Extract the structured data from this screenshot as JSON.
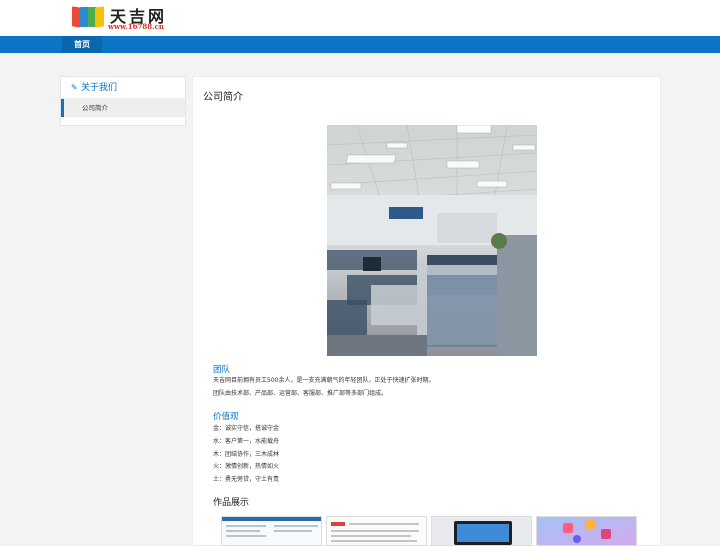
{
  "header": {
    "logo_text": "天吉网",
    "logo_url": "www.16788.cn"
  },
  "nav": {
    "home": "首页"
  },
  "sidebar": {
    "title": "关于我们",
    "items": [
      {
        "label": "公司简介"
      }
    ]
  },
  "main": {
    "title": "公司简介",
    "team": {
      "heading": "团队",
      "lines": [
        "天吉网目前拥有员工500余人，是一支充满朝气的年轻团队，正处于快速扩张时期。",
        "团队由技术部、产品部、运营部、客服部、推广部等多部门组成。"
      ]
    },
    "values": {
      "heading": "价值观",
      "lines": [
        "金：诚实守信，搭诚守金",
        "水：客户第一，水能载舟",
        "木：团结协作，三木成林",
        "火：激情创新，热情如火",
        "土：勇无旁贷，守土有责"
      ]
    },
    "works": {
      "heading": "作品展示"
    }
  },
  "colors": {
    "accent": "#0b74c4",
    "page_bg": "#f3f3f3"
  }
}
